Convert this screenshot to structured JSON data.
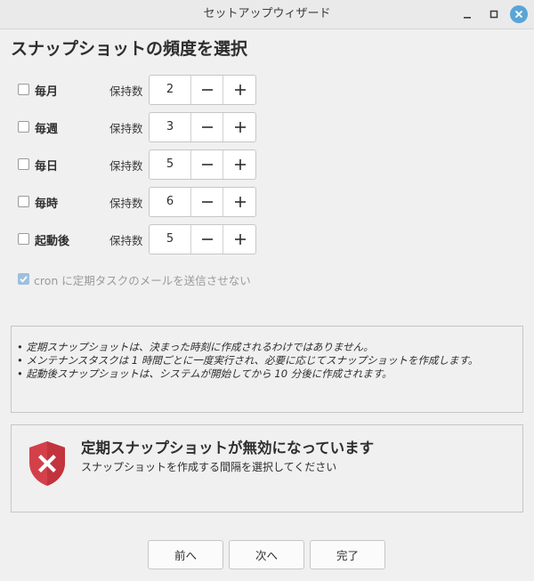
{
  "window": {
    "title": "セットアップウィザード"
  },
  "heading": "スナップショットの頻度を選択",
  "schedule": [
    {
      "label": "毎月",
      "keep_label": "保持数",
      "value": "2",
      "checked": false
    },
    {
      "label": "毎週",
      "keep_label": "保持数",
      "value": "3",
      "checked": false
    },
    {
      "label": "毎日",
      "keep_label": "保持数",
      "value": "5",
      "checked": false
    },
    {
      "label": "毎時",
      "keep_label": "保持数",
      "value": "6",
      "checked": false
    },
    {
      "label": "起動後",
      "keep_label": "保持数",
      "value": "5",
      "checked": false
    }
  ],
  "spin": {
    "minus": "−",
    "plus": "+"
  },
  "cron": {
    "label": "cron に定期タスクのメールを送信させない",
    "checked": true,
    "disabled": true
  },
  "notes": [
    "• 定期スナップショットは、決まった時刻に作成されるわけではありません。",
    "• メンテナンスタスクは 1 時間ごとに一度実行され、必要に応じてスナップショットを作成します。",
    "• 起動後スナップショットは、システムが開始してから 10 分後に作成されます。"
  ],
  "status": {
    "title": "定期スナップショットが無効になっています",
    "subtitle": "スナップショットを作成する間隔を選択してください",
    "icon": "shield-error-icon",
    "color": "#d4404a"
  },
  "buttons": {
    "prev": "前へ",
    "next": "次へ",
    "done": "完了"
  },
  "colors": {
    "accent": "#5aa5d6"
  }
}
